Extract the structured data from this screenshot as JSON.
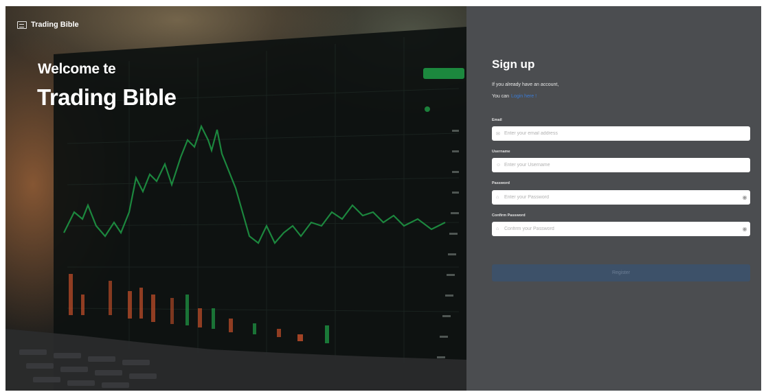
{
  "brand": {
    "name": "Trading Bible",
    "logo_icon": "book-logo-icon"
  },
  "hero": {
    "welcome_line": "Welcome te",
    "title": "Trading Bible"
  },
  "form": {
    "title": "Sign up",
    "subtitle": "If you already have an account,",
    "login_prefix": "You can",
    "login_link": "Login here !",
    "fields": {
      "email": {
        "label": "Email",
        "placeholder": "Enter your email address",
        "icon": "mail-icon"
      },
      "username": {
        "label": "Username",
        "placeholder": "Enter your Username",
        "icon": "user-icon"
      },
      "password": {
        "label": "Password",
        "placeholder": "Enter your Password",
        "icon": "lock-icon"
      },
      "confirm_password": {
        "label": "Confirm Password",
        "placeholder": "Confirm your Password",
        "icon": "lock-icon"
      }
    },
    "register_label": "Register"
  },
  "colors": {
    "panel_bg": "#4b4d50",
    "link": "#3a7bd5",
    "button_disabled": "#3d5169",
    "chart_green": "#1f9c46",
    "chart_red": "#c8502a"
  }
}
